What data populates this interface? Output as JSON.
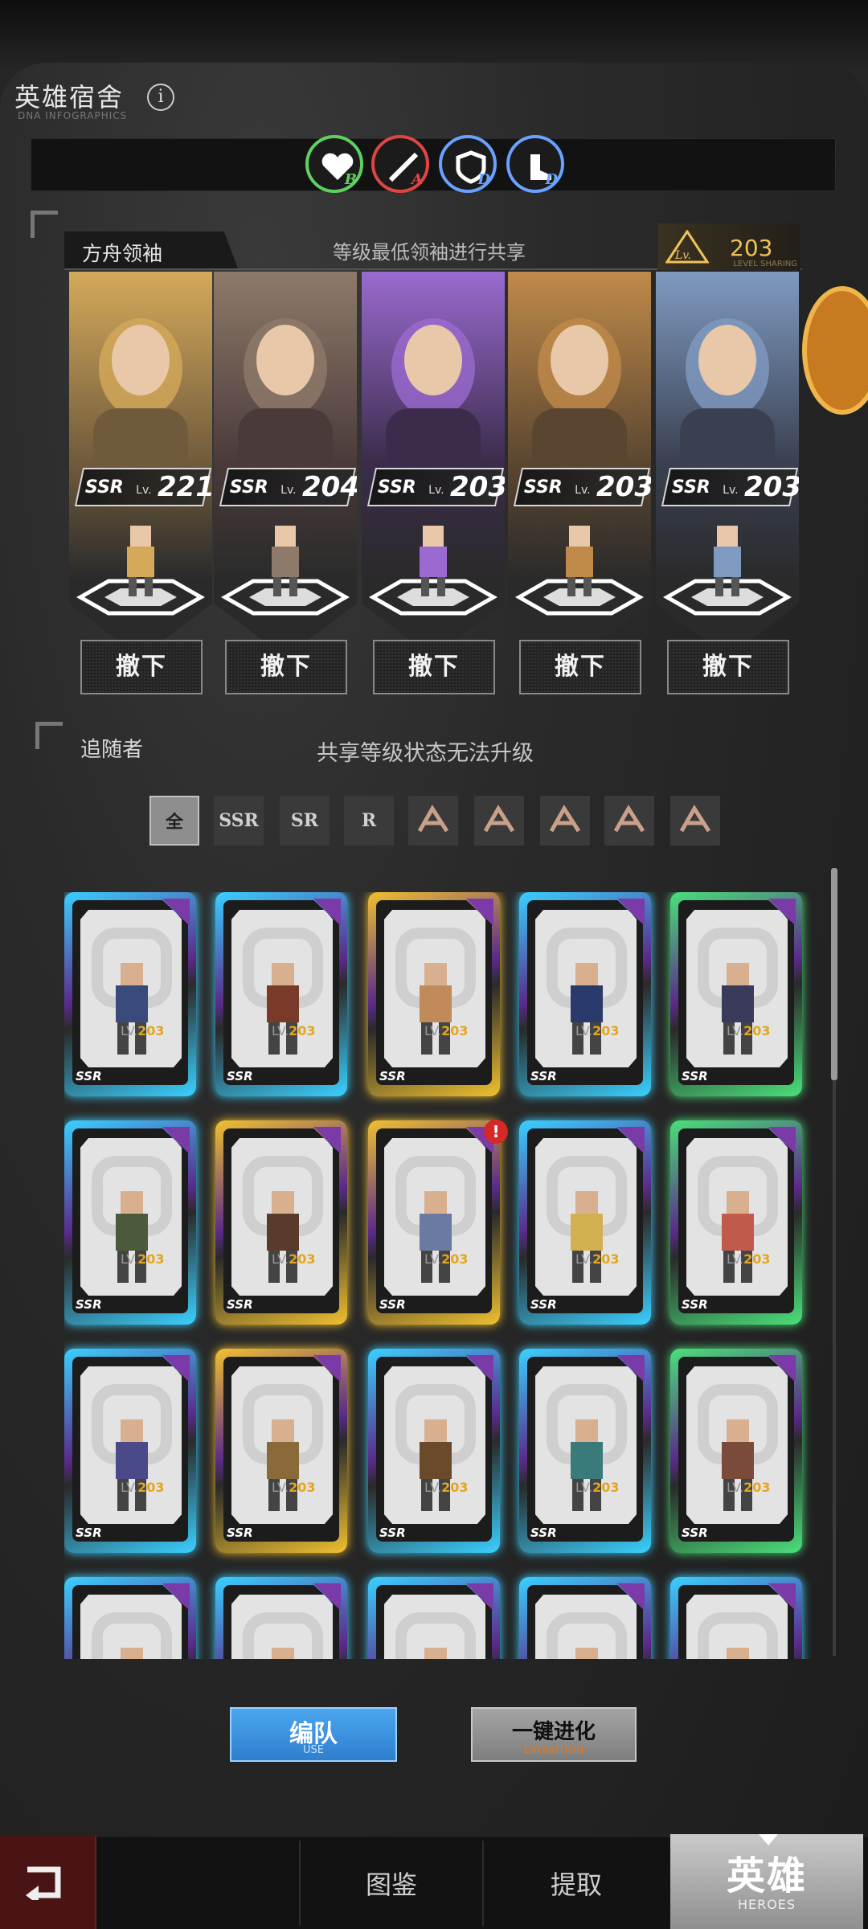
{
  "header": {
    "title": "英雄宿舍",
    "subtitle": "DNA INFOGRAPHICS",
    "info_icon": "info-icon"
  },
  "buffs": [
    {
      "icon": "heart-icon",
      "grade": "B",
      "color": "#5fd05f"
    },
    {
      "icon": "sword-icon",
      "grade": "A",
      "color": "#e04545"
    },
    {
      "icon": "shield-icon",
      "grade": "D",
      "color": "#6aa0ff"
    },
    {
      "icon": "boot-icon",
      "grade": "D",
      "color": "#6aa0ff"
    }
  ],
  "leaders": {
    "tab_label": "方舟领袖",
    "note": "等级最低领袖进行共享",
    "level_icon": "lv-pyramid-icon",
    "shared_level": "203",
    "shared_caption": "LEVEL SHARING",
    "cards": [
      {
        "rarity": "SSR",
        "lv_label": "Lv.",
        "level": "221",
        "accent": "#d4a95a",
        "portrait_color": "#6f5a3c"
      },
      {
        "rarity": "SSR",
        "lv_label": "Lv.",
        "level": "204",
        "accent": "#8e7a6a",
        "portrait_color": "#4a3a3a"
      },
      {
        "rarity": "SSR",
        "lv_label": "Lv.",
        "level": "203",
        "accent": "#9a6ad0",
        "portrait_color": "#3a2c4a"
      },
      {
        "rarity": "SSR",
        "lv_label": "Lv.",
        "level": "203",
        "accent": "#c08a4a",
        "portrait_color": "#5a4630"
      },
      {
        "rarity": "SSR",
        "lv_label": "Lv.",
        "level": "203",
        "accent": "#7f9ac0",
        "portrait_color": "#3a4050"
      }
    ],
    "remove_label": "撤下"
  },
  "followers": {
    "label": "追随者",
    "note": "共享等级状态无法升级",
    "filters": [
      "全",
      "SSR",
      "SR",
      "R",
      "faction-wing-icon",
      "faction-dragon-icon",
      "faction-snake-icon",
      "faction-claw-icon",
      "faction-infinity-icon"
    ],
    "active_filter": "全",
    "cards": [
      {
        "rarity": "SSR",
        "lv": "LV.",
        "level": "203",
        "glow": "#3ad0ff",
        "sprite": "#3a4a7a"
      },
      {
        "rarity": "SSR",
        "lv": "LV.",
        "level": "203",
        "glow": "#3ad0ff",
        "sprite": "#7a3a2a"
      },
      {
        "rarity": "SSR",
        "lv": "LV.",
        "level": "203",
        "glow": "#f0c030",
        "sprite": "#c08a5a"
      },
      {
        "rarity": "SSR",
        "lv": "LV.",
        "level": "203",
        "glow": "#3ad0ff",
        "sprite": "#2a3a6a"
      },
      {
        "rarity": "SSR",
        "lv": "LV.",
        "level": "203",
        "glow": "#4ae07a",
        "sprite": "#3a3a5a"
      },
      {
        "rarity": "SSR",
        "lv": "LV.",
        "level": "203",
        "glow": "#3ad0ff",
        "sprite": "#4a5a3a"
      },
      {
        "rarity": "SSR",
        "lv": "LV.",
        "level": "203",
        "glow": "#f0c030",
        "sprite": "#5a3a2a"
      },
      {
        "rarity": "SSR",
        "lv": "LV.",
        "level": "203",
        "glow": "#f0c030",
        "sprite": "#6a7aa0"
      },
      {
        "rarity": "SSR",
        "lv": "LV.",
        "level": "203",
        "glow": "#3ad0ff",
        "sprite": "#d0b050"
      },
      {
        "rarity": "SSR",
        "lv": "LV.",
        "level": "203",
        "glow": "#4ae07a",
        "sprite": "#c05a4a"
      },
      {
        "rarity": "SSR",
        "lv": "LV.",
        "level": "203",
        "glow": "#3ad0ff",
        "sprite": "#4a4a8a"
      },
      {
        "rarity": "SSR",
        "lv": "LV.",
        "level": "203",
        "glow": "#f0c030",
        "sprite": "#8a6a3a"
      },
      {
        "rarity": "SSR",
        "lv": "LV.",
        "level": "203",
        "glow": "#3ad0ff",
        "sprite": "#6a4a2a"
      },
      {
        "rarity": "SSR",
        "lv": "LV.",
        "level": "203",
        "glow": "#3ad0ff",
        "sprite": "#3a7a7a"
      },
      {
        "rarity": "SSR",
        "lv": "LV.",
        "level": "203",
        "glow": "#4ae07a",
        "sprite": "#7a4a3a"
      },
      {
        "rarity": "",
        "lv": "",
        "level": "",
        "glow": "#3ad0ff",
        "sprite": "#5a5a5a"
      },
      {
        "rarity": "",
        "lv": "",
        "level": "",
        "glow": "#3ad0ff",
        "sprite": "#5a5a5a"
      },
      {
        "rarity": "",
        "lv": "",
        "level": "",
        "glow": "#3ad0ff",
        "sprite": "#5a5a5a"
      },
      {
        "rarity": "",
        "lv": "",
        "level": "",
        "glow": "#3ad0ff",
        "sprite": "#5a5a5a"
      },
      {
        "rarity": "",
        "lv": "",
        "level": "",
        "glow": "#3ad0ff",
        "sprite": "#5a5a5a"
      }
    ],
    "alert_badge": "!"
  },
  "actions": {
    "use_label": "编队",
    "use_sub": "USE",
    "evolve_label": "一键进化",
    "evolve_sub": "EVOLUTION"
  },
  "nav": {
    "back_icon": "back-arrow-icon",
    "items": [
      "图鉴",
      "提取"
    ],
    "active_label": "英雄",
    "active_sub": "HEROES"
  }
}
